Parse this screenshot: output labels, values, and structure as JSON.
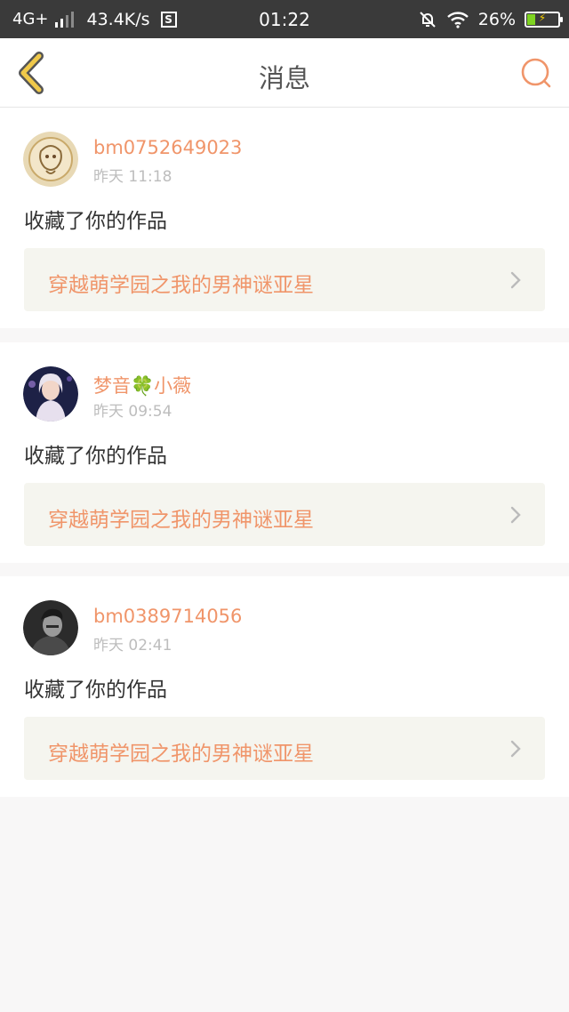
{
  "status_bar": {
    "network": "4G+",
    "speed": "43.4K/s",
    "s_icon": "S",
    "time": "01:22",
    "battery": "26%",
    "battery_level": 0.26
  },
  "nav": {
    "title": "消息",
    "back_icon": "chevron-left-icon",
    "search_icon": "search-icon"
  },
  "colors": {
    "accent": "#f0956a",
    "back_icon": "#f0c94a",
    "card_bg": "#ffffff",
    "page_bg": "#f8f7f7",
    "link_bg": "#f5f5ef"
  },
  "messages": [
    {
      "username": "bm0752649023",
      "time": "昨天 11:18",
      "action": "收藏了你的作品",
      "work_title": "穿越萌学园之我的男神谜亚星"
    },
    {
      "username_pre": "梦音",
      "username_emoji": "🍀",
      "username_post": "小薇",
      "time": "昨天 09:54",
      "action": "收藏了你的作品",
      "work_title": "穿越萌学园之我的男神谜亚星"
    },
    {
      "username": "bm0389714056",
      "time": "昨天 02:41",
      "action": "收藏了你的作品",
      "work_title": "穿越萌学园之我的男神谜亚星"
    }
  ]
}
